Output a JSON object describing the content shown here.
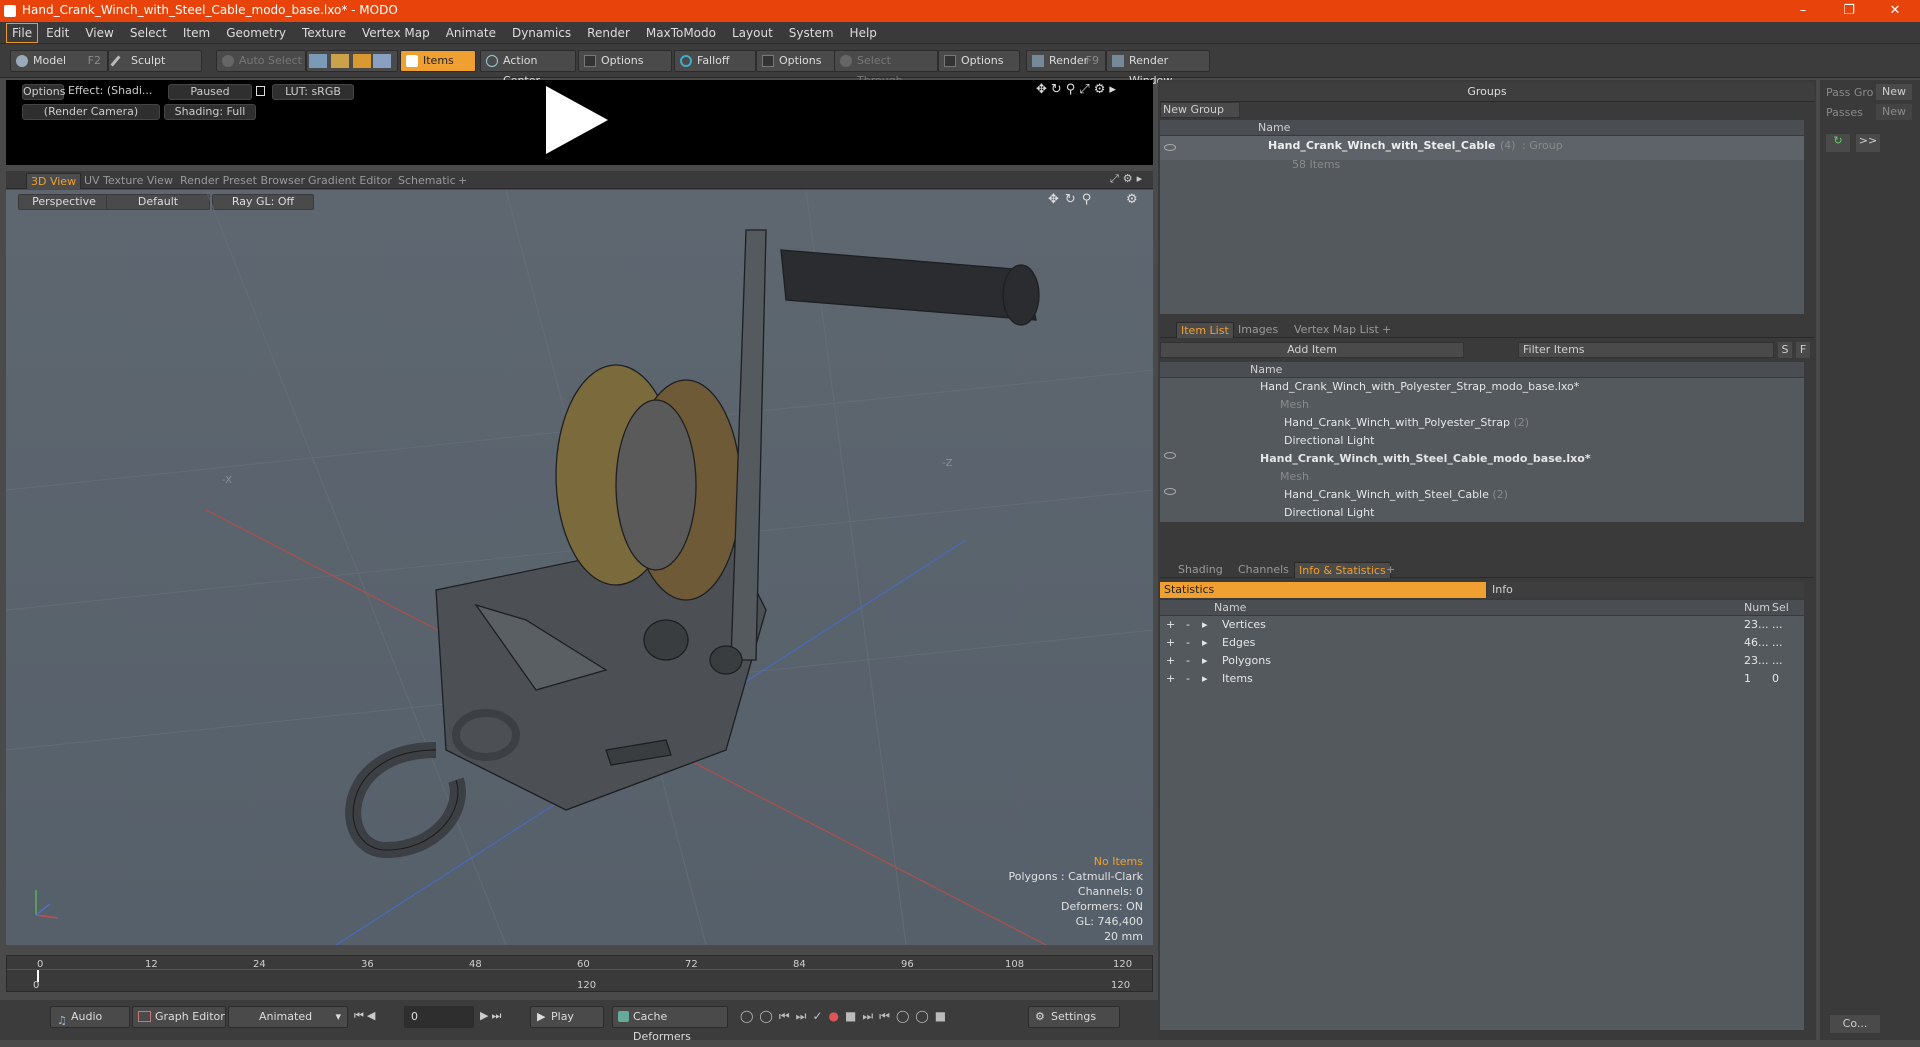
{
  "window": {
    "title": "Hand_Crank_Winch_with_Steel_Cable_modo_base.lxo* - MODO"
  },
  "menu": [
    "File",
    "Edit",
    "View",
    "Select",
    "Item",
    "Geometry",
    "Texture",
    "Vertex Map",
    "Animate",
    "Dynamics",
    "Render",
    "MaxToModo",
    "Layout",
    "System",
    "Help"
  ],
  "toolbar": {
    "model": "Model",
    "model_key": "F2",
    "sculpt": "Sculpt",
    "auto_select": "Auto Select",
    "items": "Items",
    "action_center": "Action Center",
    "options1": "Options",
    "falloff": "Falloff",
    "options2": "Options",
    "select_through": "Select Through",
    "options3": "Options",
    "render": "Render",
    "render_key": "F9",
    "render_window": "Render Window"
  },
  "render_preview": {
    "options": "Options",
    "effect": "Effect: (Shadi...",
    "paused": "Paused",
    "lut": "LUT: sRGB",
    "camera": "(Render Camera)",
    "shading": "Shading: Full"
  },
  "view_tabs": [
    "3D View",
    "UV Texture View",
    "Render Preset Browser",
    "Gradient Editor",
    "Schematic",
    "+"
  ],
  "viewport": {
    "perspective": "Perspective",
    "default": "Default",
    "raygl": "Ray GL: Off",
    "axis_x": "-X",
    "axis_z": "-Z",
    "info": {
      "no_items": "No Items",
      "polygons": "Polygons : Catmull-Clark",
      "channels": "Channels: 0",
      "deformers": "Deformers: ON",
      "gl": "GL: 746,400",
      "unit": "20 mm"
    }
  },
  "timeline": {
    "ticks": [
      "0",
      "12",
      "24",
      "36",
      "48",
      "60",
      "72",
      "84",
      "96",
      "108",
      "120"
    ],
    "low": [
      "0",
      "120",
      "120"
    ]
  },
  "bottom": {
    "audio": "Audio",
    "graph_editor": "Graph Editor",
    "animated": "Animated",
    "frame": "0",
    "play": "Play",
    "cache_deformers": "Cache Deformers",
    "settings": "Settings"
  },
  "groups": {
    "title": "Groups",
    "new_group": "New Group",
    "col_name": "Name",
    "item_name": "Hand_Crank_Winch_with_Steel_Cable",
    "item_count": "(4)",
    "item_type": ": Group",
    "item_sub": "58 Items"
  },
  "pass": {
    "pass_group": "Pass Gro",
    "new": "New",
    "passes": "Passes",
    "new2": "New",
    "more": ">>",
    "co": "Co..."
  },
  "item_list": {
    "tabs": [
      "Item List",
      "Images",
      "Vertex Map List",
      "+"
    ],
    "add_item": "Add Item",
    "filter": "Filter Items",
    "s": "S",
    "f": "F",
    "col_name": "Name",
    "rows": [
      {
        "label": "Hand_Crank_Winch_with_Polyester_Strap_modo_base.lxo*",
        "count": ""
      },
      {
        "label": "Mesh",
        "count": ""
      },
      {
        "label": "Hand_Crank_Winch_with_Polyester_Strap",
        "count": "(2)"
      },
      {
        "label": "Directional Light",
        "count": ""
      },
      {
        "label": "Hand_Crank_Winch_with_Steel_Cable_modo_base.lxo*",
        "count": ""
      },
      {
        "label": "Mesh",
        "count": ""
      },
      {
        "label": "Hand_Crank_Winch_with_Steel_Cable",
        "count": "(2)"
      },
      {
        "label": "Directional Light",
        "count": ""
      }
    ]
  },
  "stats": {
    "tabs": [
      "Shading",
      "Channels",
      "Info & Statistics",
      "+"
    ],
    "sub_tabs": [
      "Statistics",
      "Info"
    ],
    "cols": [
      "Name",
      "Num",
      "Sel"
    ],
    "rows": [
      {
        "name": "Vertices",
        "num": "23...",
        "sel": "..."
      },
      {
        "name": "Edges",
        "num": "46...",
        "sel": "..."
      },
      {
        "name": "Polygons",
        "num": "23...",
        "sel": "..."
      },
      {
        "name": "Items",
        "num": "1",
        "sel": "0"
      }
    ]
  }
}
